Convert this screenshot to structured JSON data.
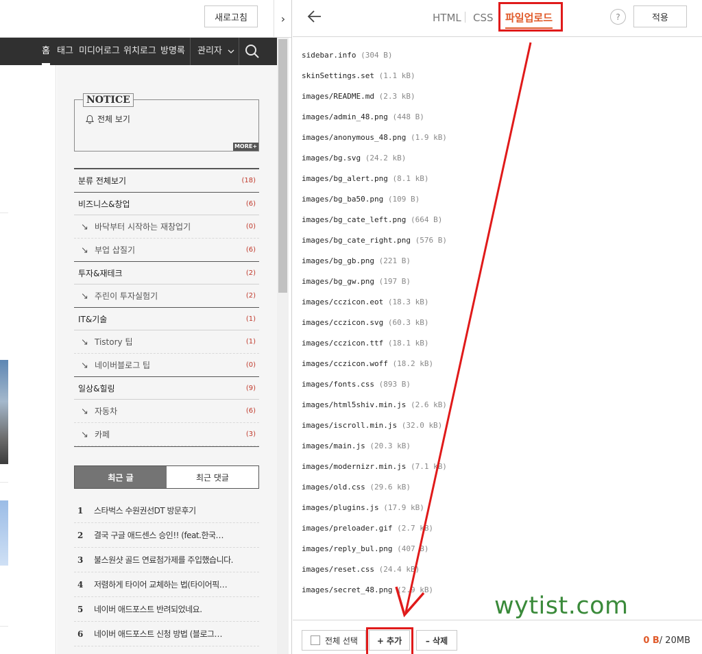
{
  "preview": {
    "refresh_label": "새로고침",
    "collapse_glyph": "›",
    "nav": {
      "home": "홈",
      "tags": "태그",
      "medialog": "미디어로그",
      "locationlog": "위치로그",
      "guestbook": "방명록",
      "admin": "관리자"
    },
    "notice": {
      "title": "NOTICE",
      "view_all": "전체 보기",
      "more": "MORE+"
    },
    "categories": [
      {
        "name": "분류 전체보기",
        "count": "(18)",
        "level": "main"
      },
      {
        "name": "비즈니스&창업",
        "count": "(6)",
        "level": "main"
      },
      {
        "name": "바닥부터 시작하는 재창업기",
        "count": "(0)",
        "level": "sub"
      },
      {
        "name": "부업 삽질기",
        "count": "(6)",
        "level": "sub"
      },
      {
        "name": "투자&재테크",
        "count": "(2)",
        "level": "main"
      },
      {
        "name": "주린이 투자실험기",
        "count": "(2)",
        "level": "sub"
      },
      {
        "name": "IT&기술",
        "count": "(1)",
        "level": "main"
      },
      {
        "name": "Tistory 팁",
        "count": "(1)",
        "level": "sub"
      },
      {
        "name": "네이버블로그 팁",
        "count": "(0)",
        "level": "sub"
      },
      {
        "name": "일상&힐링",
        "count": "(9)",
        "level": "main"
      },
      {
        "name": "자동차",
        "count": "(6)",
        "level": "sub"
      },
      {
        "name": "카페",
        "count": "(3)",
        "level": "sub"
      }
    ],
    "sub_arrow": "↘",
    "recent_tabs": {
      "posts": "최근 글",
      "comments": "최근 댓글"
    },
    "recent_posts": [
      {
        "num": "1",
        "title": "스타벅스 수원권선DT 방문후기"
      },
      {
        "num": "2",
        "title": "결국 구글 애드센스 승인!! (feat.한국…"
      },
      {
        "num": "3",
        "title": "불스원샷 골드 연료첨가제를 주입했습니다."
      },
      {
        "num": "4",
        "title": "저렴하게 타이어 교체하는 법(타이어픽…"
      },
      {
        "num": "5",
        "title": "네이버 애드포스트 반려되었네요."
      },
      {
        "num": "6",
        "title": "네이버 애드포스트 신청 방법 (블로그…"
      }
    ]
  },
  "editor": {
    "tabs": {
      "html": "HTML",
      "css": "CSS",
      "upload": "파일업로드"
    },
    "help": "?",
    "apply_label": "적용",
    "files": [
      {
        "name": "sidebar.info",
        "size": "(304 B)"
      },
      {
        "name": "skinSettings.set",
        "size": "(1.1 kB)"
      },
      {
        "name": "images/README.md",
        "size": "(2.3 kB)"
      },
      {
        "name": "images/admin_48.png",
        "size": "(448 B)"
      },
      {
        "name": "images/anonymous_48.png",
        "size": "(1.9 kB)"
      },
      {
        "name": "images/bg.svg",
        "size": "(24.2 kB)"
      },
      {
        "name": "images/bg_alert.png",
        "size": "(8.1 kB)"
      },
      {
        "name": "images/bg_ba50.png",
        "size": "(109 B)"
      },
      {
        "name": "images/bg_cate_left.png",
        "size": "(664 B)"
      },
      {
        "name": "images/bg_cate_right.png",
        "size": "(576 B)"
      },
      {
        "name": "images/bg_gb.png",
        "size": "(221 B)"
      },
      {
        "name": "images/bg_gw.png",
        "size": "(197 B)"
      },
      {
        "name": "images/cczicon.eot",
        "size": "(18.3 kB)"
      },
      {
        "name": "images/cczicon.svg",
        "size": "(60.3 kB)"
      },
      {
        "name": "images/cczicon.ttf",
        "size": "(18.1 kB)"
      },
      {
        "name": "images/cczicon.woff",
        "size": "(18.2 kB)"
      },
      {
        "name": "images/fonts.css",
        "size": "(893 B)"
      },
      {
        "name": "images/html5shiv.min.js",
        "size": "(2.6 kB)"
      },
      {
        "name": "images/iscroll.min.js",
        "size": "(32.0 kB)"
      },
      {
        "name": "images/main.js",
        "size": "(20.3 kB)"
      },
      {
        "name": "images/modernizr.min.js",
        "size": "(7.1 kB)"
      },
      {
        "name": "images/old.css",
        "size": "(29.6 kB)"
      },
      {
        "name": "images/plugins.js",
        "size": "(17.9 kB)"
      },
      {
        "name": "images/preloader.gif",
        "size": "(2.7 kB)"
      },
      {
        "name": "images/reply_bul.png",
        "size": "(407 B)"
      },
      {
        "name": "images/reset.css",
        "size": "(24.4 kB)"
      },
      {
        "name": "images/secret_48.png",
        "size": "(2.9 kB)"
      }
    ],
    "watermark": "wytist.com",
    "bottom": {
      "select_all": "전체 선택",
      "add": "+ 추가",
      "delete": "– 삭제",
      "usage_used": "0 B",
      "usage_total": "/ 20MB"
    }
  },
  "colors": {
    "accent": "#e05a2a",
    "annotation_red": "#e01a1a",
    "nav_bg": "#303030",
    "watermark_green": "#3a8a3a"
  }
}
